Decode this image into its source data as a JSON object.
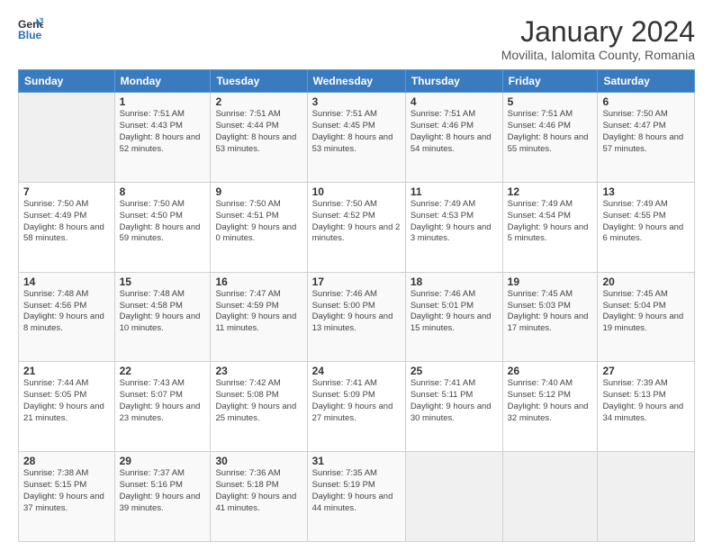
{
  "logo": {
    "general": "General",
    "blue": "Blue"
  },
  "title": "January 2024",
  "subtitle": "Movilita, Ialomita County, Romania",
  "days_header": [
    "Sunday",
    "Monday",
    "Tuesday",
    "Wednesday",
    "Thursday",
    "Friday",
    "Saturday"
  ],
  "weeks": [
    [
      {
        "num": "",
        "sunrise": "",
        "sunset": "",
        "daylight": ""
      },
      {
        "num": "1",
        "sunrise": "Sunrise: 7:51 AM",
        "sunset": "Sunset: 4:43 PM",
        "daylight": "Daylight: 8 hours and 52 minutes."
      },
      {
        "num": "2",
        "sunrise": "Sunrise: 7:51 AM",
        "sunset": "Sunset: 4:44 PM",
        "daylight": "Daylight: 8 hours and 53 minutes."
      },
      {
        "num": "3",
        "sunrise": "Sunrise: 7:51 AM",
        "sunset": "Sunset: 4:45 PM",
        "daylight": "Daylight: 8 hours and 53 minutes."
      },
      {
        "num": "4",
        "sunrise": "Sunrise: 7:51 AM",
        "sunset": "Sunset: 4:46 PM",
        "daylight": "Daylight: 8 hours and 54 minutes."
      },
      {
        "num": "5",
        "sunrise": "Sunrise: 7:51 AM",
        "sunset": "Sunset: 4:46 PM",
        "daylight": "Daylight: 8 hours and 55 minutes."
      },
      {
        "num": "6",
        "sunrise": "Sunrise: 7:50 AM",
        "sunset": "Sunset: 4:47 PM",
        "daylight": "Daylight: 8 hours and 57 minutes."
      }
    ],
    [
      {
        "num": "7",
        "sunrise": "Sunrise: 7:50 AM",
        "sunset": "Sunset: 4:49 PM",
        "daylight": "Daylight: 8 hours and 58 minutes."
      },
      {
        "num": "8",
        "sunrise": "Sunrise: 7:50 AM",
        "sunset": "Sunset: 4:50 PM",
        "daylight": "Daylight: 8 hours and 59 minutes."
      },
      {
        "num": "9",
        "sunrise": "Sunrise: 7:50 AM",
        "sunset": "Sunset: 4:51 PM",
        "daylight": "Daylight: 9 hours and 0 minutes."
      },
      {
        "num": "10",
        "sunrise": "Sunrise: 7:50 AM",
        "sunset": "Sunset: 4:52 PM",
        "daylight": "Daylight: 9 hours and 2 minutes."
      },
      {
        "num": "11",
        "sunrise": "Sunrise: 7:49 AM",
        "sunset": "Sunset: 4:53 PM",
        "daylight": "Daylight: 9 hours and 3 minutes."
      },
      {
        "num": "12",
        "sunrise": "Sunrise: 7:49 AM",
        "sunset": "Sunset: 4:54 PM",
        "daylight": "Daylight: 9 hours and 5 minutes."
      },
      {
        "num": "13",
        "sunrise": "Sunrise: 7:49 AM",
        "sunset": "Sunset: 4:55 PM",
        "daylight": "Daylight: 9 hours and 6 minutes."
      }
    ],
    [
      {
        "num": "14",
        "sunrise": "Sunrise: 7:48 AM",
        "sunset": "Sunset: 4:56 PM",
        "daylight": "Daylight: 9 hours and 8 minutes."
      },
      {
        "num": "15",
        "sunrise": "Sunrise: 7:48 AM",
        "sunset": "Sunset: 4:58 PM",
        "daylight": "Daylight: 9 hours and 10 minutes."
      },
      {
        "num": "16",
        "sunrise": "Sunrise: 7:47 AM",
        "sunset": "Sunset: 4:59 PM",
        "daylight": "Daylight: 9 hours and 11 minutes."
      },
      {
        "num": "17",
        "sunrise": "Sunrise: 7:46 AM",
        "sunset": "Sunset: 5:00 PM",
        "daylight": "Daylight: 9 hours and 13 minutes."
      },
      {
        "num": "18",
        "sunrise": "Sunrise: 7:46 AM",
        "sunset": "Sunset: 5:01 PM",
        "daylight": "Daylight: 9 hours and 15 minutes."
      },
      {
        "num": "19",
        "sunrise": "Sunrise: 7:45 AM",
        "sunset": "Sunset: 5:03 PM",
        "daylight": "Daylight: 9 hours and 17 minutes."
      },
      {
        "num": "20",
        "sunrise": "Sunrise: 7:45 AM",
        "sunset": "Sunset: 5:04 PM",
        "daylight": "Daylight: 9 hours and 19 minutes."
      }
    ],
    [
      {
        "num": "21",
        "sunrise": "Sunrise: 7:44 AM",
        "sunset": "Sunset: 5:05 PM",
        "daylight": "Daylight: 9 hours and 21 minutes."
      },
      {
        "num": "22",
        "sunrise": "Sunrise: 7:43 AM",
        "sunset": "Sunset: 5:07 PM",
        "daylight": "Daylight: 9 hours and 23 minutes."
      },
      {
        "num": "23",
        "sunrise": "Sunrise: 7:42 AM",
        "sunset": "Sunset: 5:08 PM",
        "daylight": "Daylight: 9 hours and 25 minutes."
      },
      {
        "num": "24",
        "sunrise": "Sunrise: 7:41 AM",
        "sunset": "Sunset: 5:09 PM",
        "daylight": "Daylight: 9 hours and 27 minutes."
      },
      {
        "num": "25",
        "sunrise": "Sunrise: 7:41 AM",
        "sunset": "Sunset: 5:11 PM",
        "daylight": "Daylight: 9 hours and 30 minutes."
      },
      {
        "num": "26",
        "sunrise": "Sunrise: 7:40 AM",
        "sunset": "Sunset: 5:12 PM",
        "daylight": "Daylight: 9 hours and 32 minutes."
      },
      {
        "num": "27",
        "sunrise": "Sunrise: 7:39 AM",
        "sunset": "Sunset: 5:13 PM",
        "daylight": "Daylight: 9 hours and 34 minutes."
      }
    ],
    [
      {
        "num": "28",
        "sunrise": "Sunrise: 7:38 AM",
        "sunset": "Sunset: 5:15 PM",
        "daylight": "Daylight: 9 hours and 37 minutes."
      },
      {
        "num": "29",
        "sunrise": "Sunrise: 7:37 AM",
        "sunset": "Sunset: 5:16 PM",
        "daylight": "Daylight: 9 hours and 39 minutes."
      },
      {
        "num": "30",
        "sunrise": "Sunrise: 7:36 AM",
        "sunset": "Sunset: 5:18 PM",
        "daylight": "Daylight: 9 hours and 41 minutes."
      },
      {
        "num": "31",
        "sunrise": "Sunrise: 7:35 AM",
        "sunset": "Sunset: 5:19 PM",
        "daylight": "Daylight: 9 hours and 44 minutes."
      },
      {
        "num": "",
        "sunrise": "",
        "sunset": "",
        "daylight": ""
      },
      {
        "num": "",
        "sunrise": "",
        "sunset": "",
        "daylight": ""
      },
      {
        "num": "",
        "sunrise": "",
        "sunset": "",
        "daylight": ""
      }
    ]
  ]
}
